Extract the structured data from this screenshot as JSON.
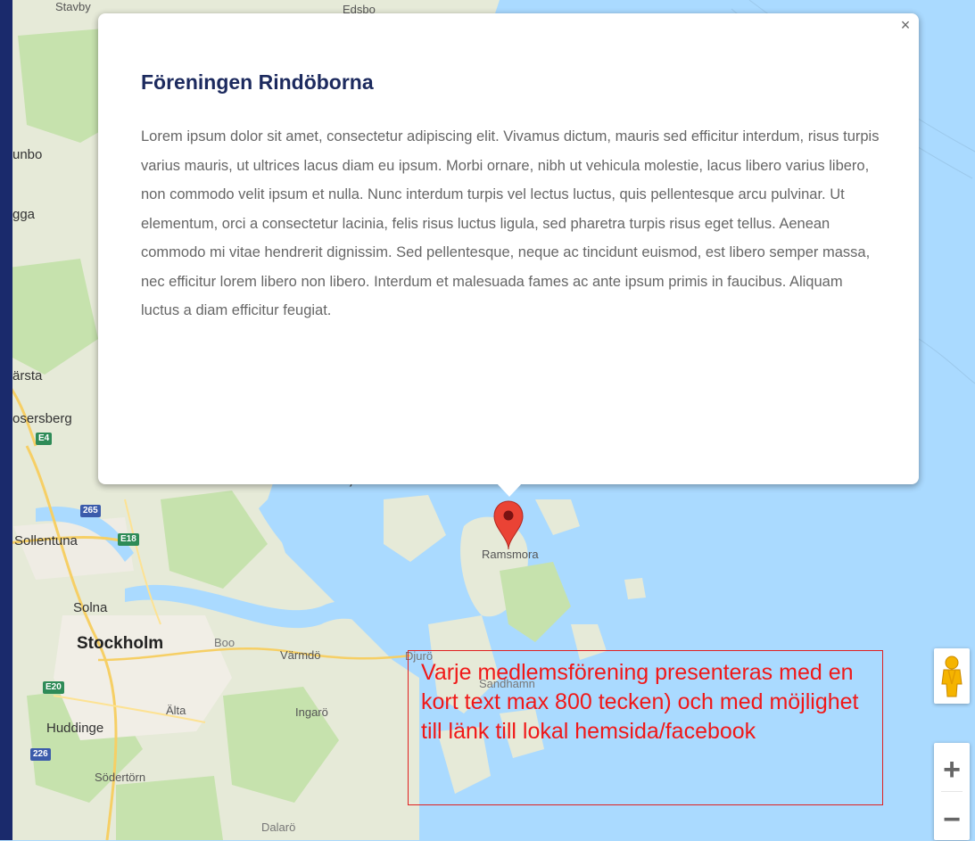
{
  "map": {
    "labels": {
      "stavby": "Stavby",
      "edsbo": "Edsbo",
      "unbo": "unbo",
      "gga": "gga",
      "arsta": "ärsta",
      "rosersberg": "osersberg",
      "sollentuna": "Sollentuna",
      "solna": "Solna",
      "stockholm": "Stockholm",
      "boo": "Boo",
      "varmdo": "Värmdö",
      "alta": "Älta",
      "ingaro": "Ingarö",
      "huddinge": "Huddinge",
      "sodertorn": "Södertörn",
      "dalaro": "Dalarö",
      "ramsmora": "Ramsmora",
      "djuro": "Djurö",
      "sandhamn": "Sandhamn",
      "ljusterö": "Ljusterö"
    },
    "shields": {
      "e4": "E4",
      "r265": "265",
      "e18": "E18",
      "e20": "E20",
      "r226": "226"
    }
  },
  "infowindow": {
    "title": "Föreningen Rindöborna",
    "body": "Lorem ipsum dolor sit amet, consectetur adipiscing elit. Vivamus dictum, mauris sed efficitur interdum, risus turpis varius mauris, ut ultrices lacus diam eu ipsum. Morbi ornare, nibh ut vehicula molestie, lacus libero varius libero, non commodo velit ipsum et nulla. Nunc interdum turpis vel lectus luctus, quis pellentesque arcu pulvinar. Ut elementum, orci a consectetur lacinia, felis risus luctus ligula, sed pharetra turpis risus eget tellus. Aenean commodo mi vitae hendrerit dignissim. Sed pellentesque, neque ac tincidunt euismod, est libero semper massa, nec efficitur lorem libero non libero. Interdum et malesuada fames ac ante ipsum primis in faucibus. Aliquam luctus a diam efficitur feugiat.",
    "close_label": "×"
  },
  "controls": {
    "zoom_in": "+",
    "zoom_out": "−",
    "pegman_icon": "pegman-icon"
  },
  "annotation": {
    "text": "Varje medlemsförening presenteras med en kort text max 800 tecken) och med möjlighet till länk till lokal hemsida/facebook"
  },
  "colors": {
    "water": "#aadaff",
    "land": "#e8eadc",
    "forest": "#c9e3b0",
    "title": "#1c2a5e",
    "marker": "#ea4335",
    "annotation": "#f01818",
    "sidebar": "#1a2a6c"
  }
}
